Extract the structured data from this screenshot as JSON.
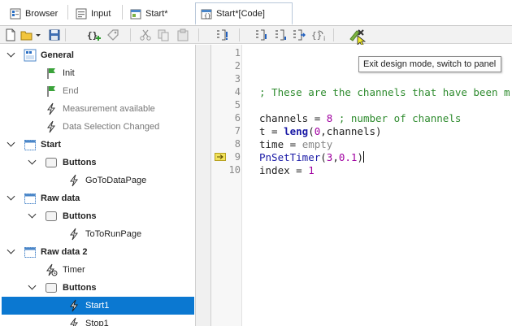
{
  "tabs": [
    {
      "label": "Browser",
      "icon": "browser-icon"
    },
    {
      "label": "Input",
      "icon": "input-icon"
    },
    {
      "label": "Start*",
      "icon": "panel-icon"
    },
    {
      "label": "Start*[Code]",
      "icon": "code-panel-icon",
      "active": true
    }
  ],
  "toolbar": {
    "buttons": [
      "new-icon",
      "open-folder-icon",
      "dropdown-icon",
      "save-icon",
      "add-event-icon",
      "tag-icon",
      "cut-icon",
      "copy-icon",
      "paste-icon",
      "run-to-line-icon",
      "step-into-icon",
      "step-over-icon",
      "step-out-icon",
      "step-run-icon",
      "exit-design-mode-icon"
    ],
    "tooltip": "Exit design mode, switch to  panel"
  },
  "tree": {
    "items": [
      {
        "label": "General",
        "bold": true
      },
      {
        "label": "Init"
      },
      {
        "label": "End",
        "dim": true
      },
      {
        "label": "Measurement available",
        "dim": true
      },
      {
        "label": "Data Selection Changed",
        "dim": true
      },
      {
        "label": "Start",
        "bold": true
      },
      {
        "label": "Buttons",
        "bold": true
      },
      {
        "label": "GoToDataPage"
      },
      {
        "label": "Raw data",
        "bold": true
      },
      {
        "label": "Buttons",
        "bold": true
      },
      {
        "label": "ToToRunPage"
      },
      {
        "label": "Raw data 2",
        "bold": true
      },
      {
        "label": "Timer"
      },
      {
        "label": "Buttons",
        "bold": true
      },
      {
        "label": "Start1",
        "selected": true
      },
      {
        "label": "Stop1"
      }
    ]
  },
  "editor": {
    "line_numbers": [
      "1",
      "2",
      "3",
      "4",
      "5",
      "6",
      "7",
      "8",
      "9",
      "10"
    ],
    "current_line": "9",
    "lines": {
      "l4_comment": "; These are the channels that have been m",
      "l6_a": "channels = ",
      "l6_num": "8",
      "l6_comment": " ; number of channels",
      "l7_a": "t = ",
      "l7_kw": "leng",
      "l7_b": "(",
      "l7_num": "0",
      "l7_c": ",channels)",
      "l8_a": "time = ",
      "l8_gray": "empty",
      "l9_kw": "PnSetTimer",
      "l9_a": "(",
      "l9_n1": "3",
      "l9_b": ",",
      "l9_n2": "0.1",
      "l9_c": ")",
      "l10_a": "index = ",
      "l10_num": "1"
    }
  }
}
